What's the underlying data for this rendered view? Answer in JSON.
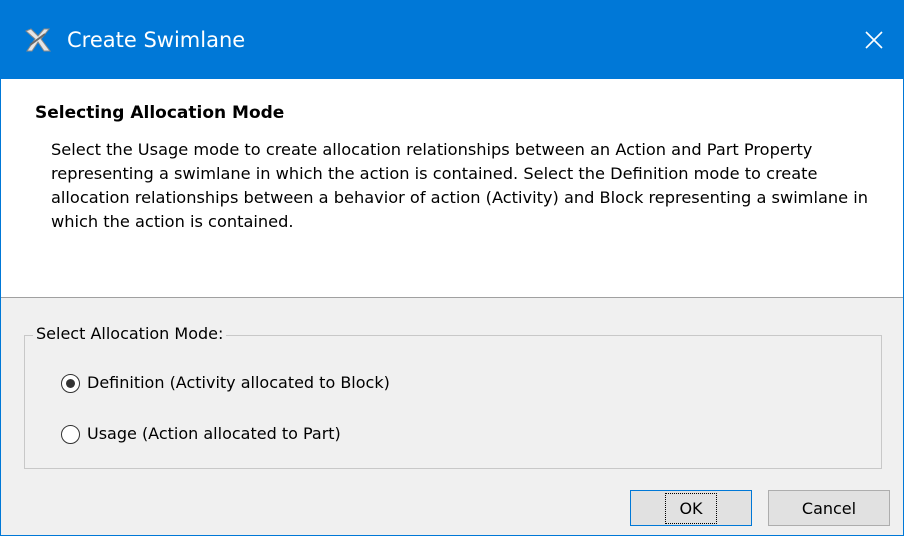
{
  "window": {
    "title": "Create Swimlane",
    "accent_color": "#0078d7"
  },
  "header": {
    "title": "Selecting Allocation Mode",
    "description": "Select the Usage mode to create allocation relationships between an Action and Part Property representing a swimlane in which the action is contained. Select the Definition mode to create allocation relationships between a behavior of action (Activity) and Block representing a swimlane in which the action is contained."
  },
  "allocation_group": {
    "legend": "Select Allocation Mode:",
    "options": [
      {
        "label": "Definition (Activity allocated to Block)",
        "selected": true
      },
      {
        "label": "Usage (Action allocated to Part)",
        "selected": false
      }
    ]
  },
  "buttons": {
    "ok": "OK",
    "cancel": "Cancel"
  }
}
